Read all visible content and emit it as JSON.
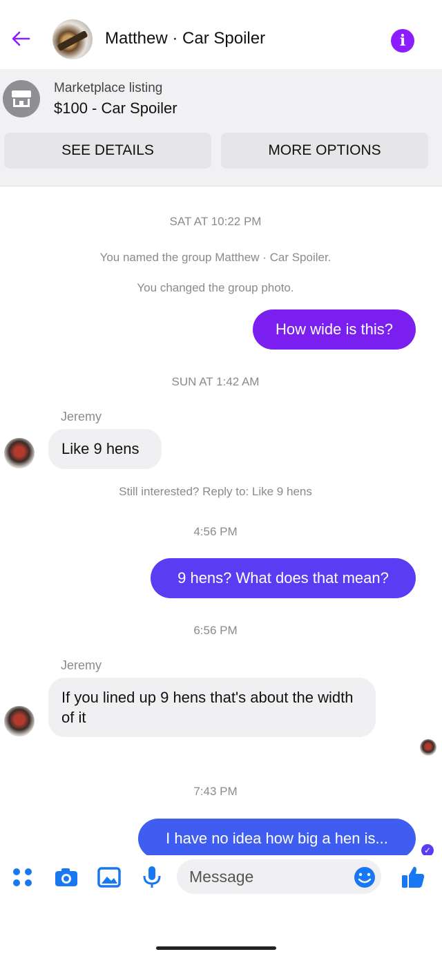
{
  "header": {
    "title": "Matthew · Car Spoiler",
    "info_icon_label": "i"
  },
  "listing": {
    "kind": "Marketplace listing",
    "title": "$100 - Car Spoiler",
    "see_details_label": "SEE DETAILS",
    "more_options_label": "MORE OPTIONS"
  },
  "conversation": {
    "timestamps": [
      "SAT AT 10:22 PM",
      "SUN AT 1:42 AM",
      "4:56 PM",
      "6:56 PM",
      "7:43 PM"
    ],
    "system_messages": [
      "You named the group Matthew · Car Spoiler.",
      "You changed the group photo.",
      "Still interested? Reply to: Like 9 hens"
    ],
    "messages": [
      {
        "from": "me",
        "text": "How wide is this?"
      },
      {
        "from": "Jeremy",
        "text": "Like 9 hens"
      },
      {
        "from": "me",
        "text": "9 hens? What does that mean?"
      },
      {
        "from": "Jeremy",
        "text": "If you lined up 9 hens that's about the width of it"
      },
      {
        "from": "me",
        "text": "I have no idea how big a hen is..."
      }
    ],
    "sender_name": "Jeremy"
  },
  "composer": {
    "placeholder": "Message"
  },
  "colors": {
    "accent_purple": "#7b1ff0",
    "accent_blue": "#3f5df0",
    "icon_blue": "#1877f2"
  }
}
